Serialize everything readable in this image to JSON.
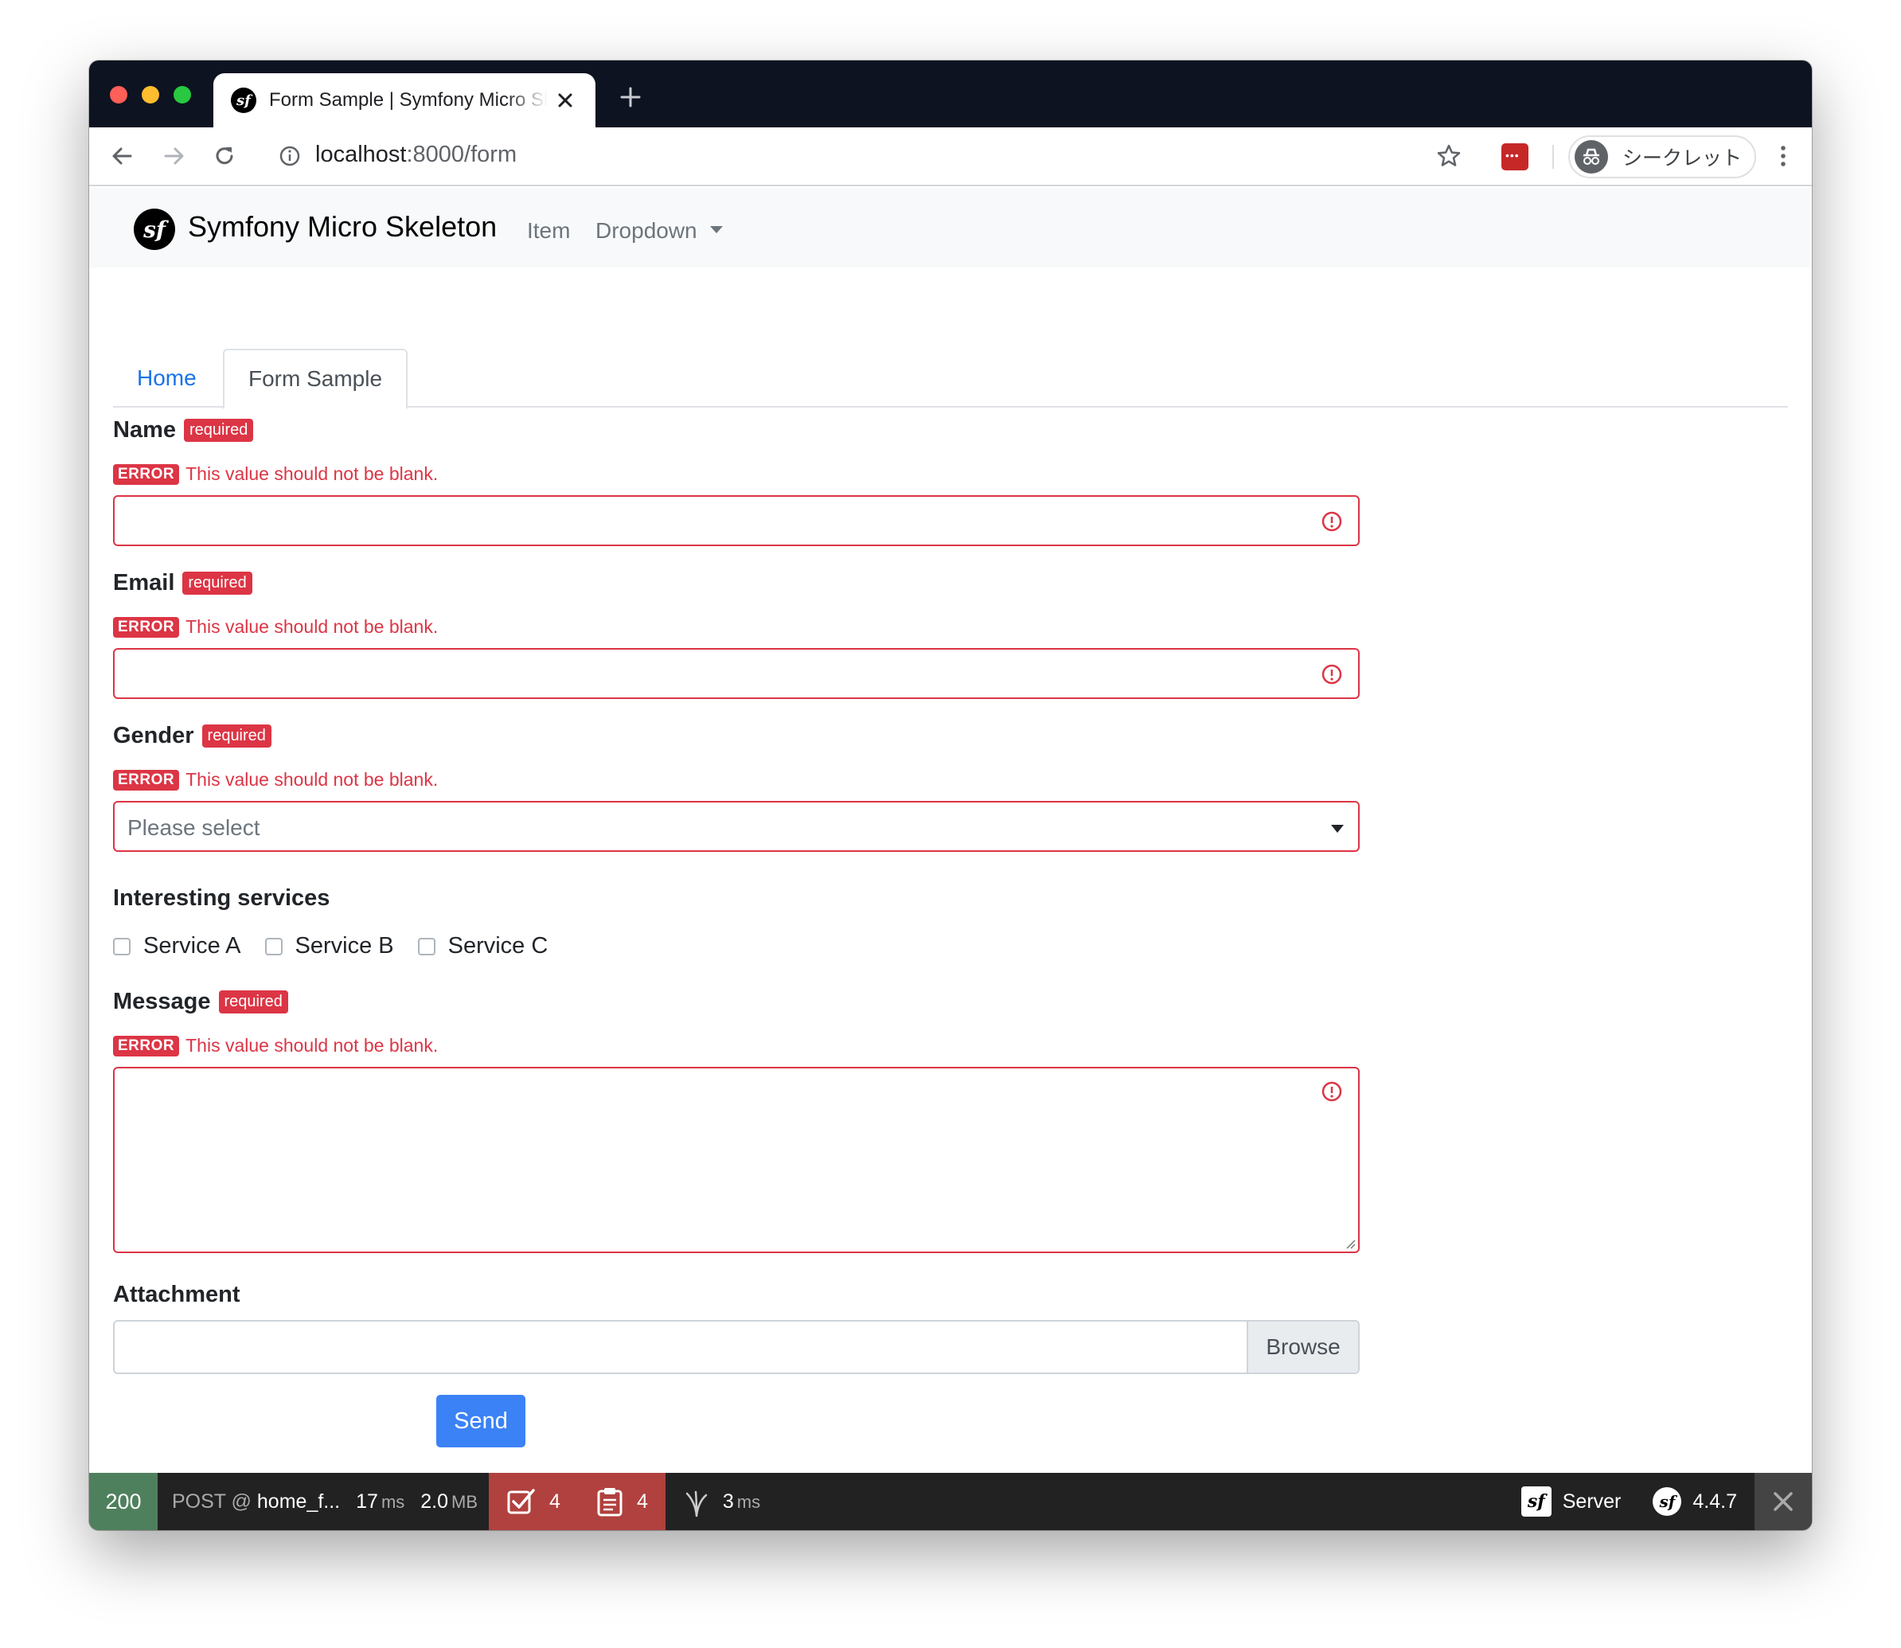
{
  "browser": {
    "tab_title": "Form Sample | Symfony Micro Skeleton",
    "url_host": "localhost",
    "url_rest": ":8000/form",
    "profile_label": "シークレット"
  },
  "navbar": {
    "brand": "Symfony Micro Skeleton",
    "items": [
      "Item",
      "Dropdown"
    ]
  },
  "tabs": [
    "Home",
    "Form Sample"
  ],
  "form": {
    "required_badge": "required",
    "error_badge": "ERROR",
    "error_text": "This value should not be blank.",
    "name_label": "Name",
    "email_label": "Email",
    "gender_label": "Gender",
    "gender_placeholder": "Please select",
    "services_label": "Interesting services",
    "services": [
      "Service A",
      "Service B",
      "Service C"
    ],
    "message_label": "Message",
    "attachment_label": "Attachment",
    "browse_label": "Browse",
    "send_label": "Send"
  },
  "debug_toolbar": {
    "status": "200",
    "method": "POST @",
    "route": "home_f...",
    "time_value": "17",
    "time_unit": "ms",
    "memory_value": "2.0",
    "memory_unit": "MB",
    "validator_count": "4",
    "logs_count": "4",
    "twig_value": "3",
    "twig_unit": "ms",
    "server_label": "Server",
    "version": "4.4.7"
  },
  "colors": {
    "error": "#dc3545",
    "primary": "#3b82f6",
    "status_ok": "#4f805d",
    "toolbar_alert": "#b0413e"
  }
}
